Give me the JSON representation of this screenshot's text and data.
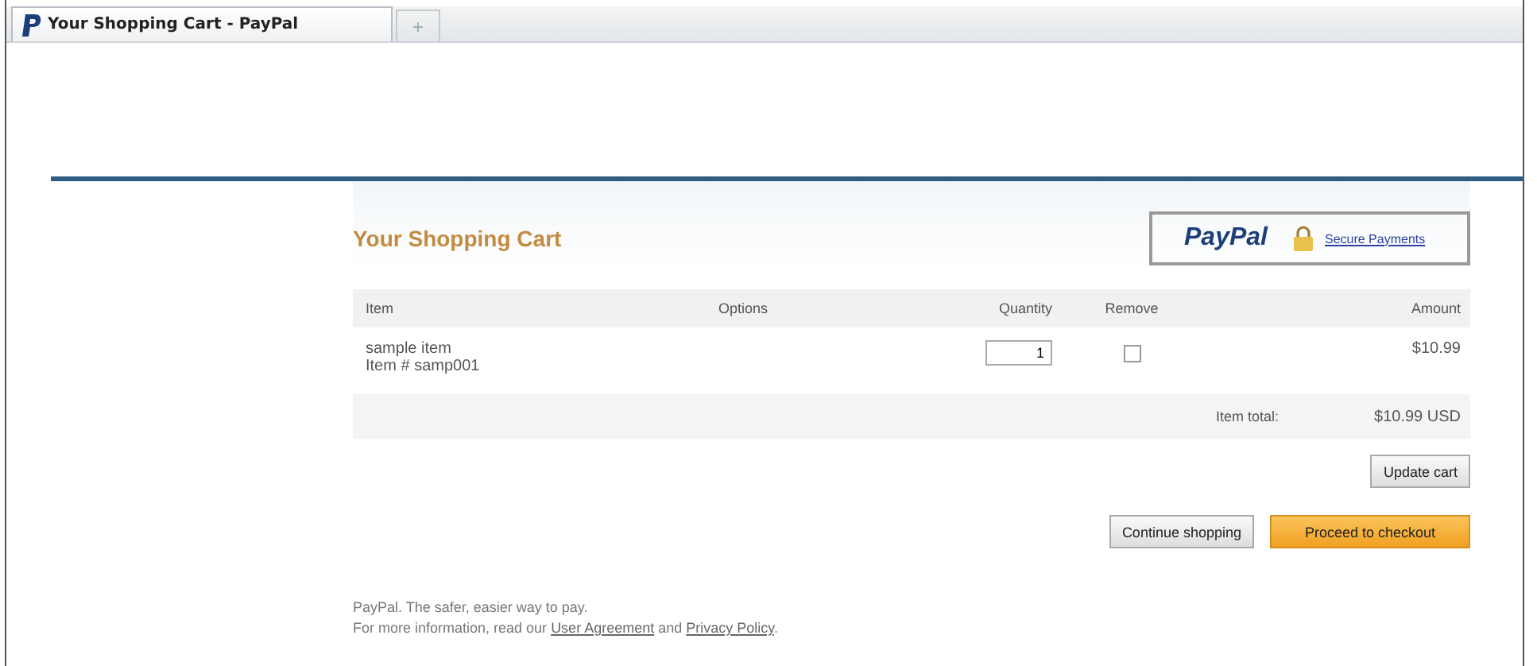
{
  "browser": {
    "tab_title": "Your Shopping Cart - PayPal",
    "new_tab": "+"
  },
  "page": {
    "title": "Your Shopping Cart",
    "brand": "PayPal",
    "secure_link": "Secure Payments"
  },
  "table": {
    "columns": [
      "Item",
      "Options",
      "Quantity",
      "Remove",
      "Amount"
    ],
    "rows": [
      {
        "item_name": "sample item",
        "item_number": "Item # samp001",
        "quantity": "1",
        "remove_checked": false,
        "amount": "$10.99"
      }
    ],
    "total_label": "Item total:",
    "total": "$10.99 USD"
  },
  "update_button": "Update cart",
  "actions": [
    {
      "label": "Continue shopping",
      "kind": "secondary"
    },
    {
      "label": "Proceed to checkout",
      "kind": "primary"
    }
  ],
  "footer": {
    "tagline": "PayPal. The safer, easier way to pay.",
    "info": [
      {
        "kind": "text",
        "text": "For more information, read our "
      },
      {
        "kind": "link",
        "text": "User Agreement"
      },
      {
        "kind": "text",
        "text": " and "
      },
      {
        "kind": "link",
        "text": "Privacy Policy"
      },
      {
        "kind": "text",
        "text": "."
      }
    ]
  }
}
